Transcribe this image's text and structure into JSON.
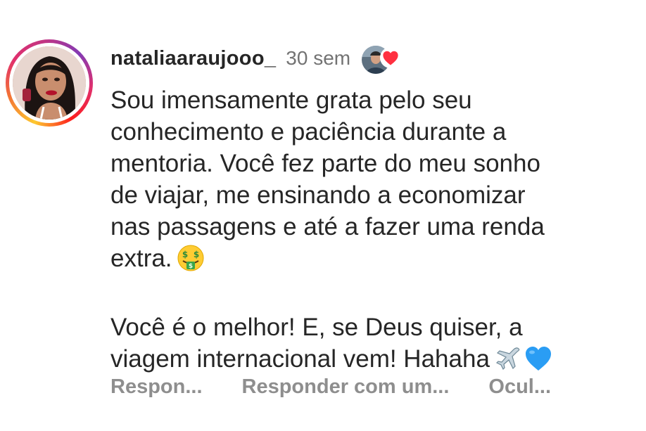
{
  "comment": {
    "username": "nataliaaraujooo_",
    "time": "30 sem",
    "paragraph1_lines": [
      "Sou imensamente grata pelo seu",
      "conhecimento e paciência durante a",
      "mentoria. Você fez parte do meu sonho",
      "de viajar, me ensinando a economizar",
      "nas passagens e até a fazer uma renda",
      "extra."
    ],
    "paragraph2_lines": [
      "Você é o melhor! E, se Deus quiser, a",
      "viagem internacional vem! Hahaha"
    ],
    "emoji1": "money-mouth-face",
    "emoji2": [
      "airplane",
      "blue-heart"
    ]
  },
  "actions": {
    "reply": "Respon...",
    "reply_with": "Responder com um...",
    "hide": "Ocul..."
  },
  "colors": {
    "text": "#262626",
    "secondary": "#737373",
    "action": "#8e8e8e",
    "heart": "#ff3040",
    "blue_heart": "#2a9df4"
  }
}
